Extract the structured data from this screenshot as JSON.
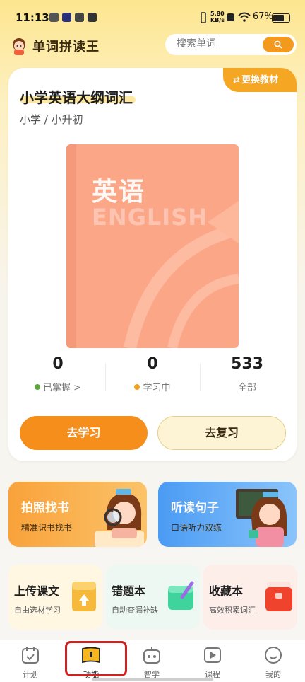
{
  "status_bar": {
    "time": "11:13",
    "net_speed": "5.80\nKB/s",
    "battery": "67%"
  },
  "header": {
    "app_name": "单词拼读王",
    "search_placeholder": "搜索单词"
  },
  "book": {
    "swap_label": "更换教材",
    "title": "小学英语大纲词汇",
    "subtitle": "小学 / 小升初",
    "cover_cn": "英语",
    "cover_en": "ENGLISH"
  },
  "stats": [
    {
      "value": "0",
      "label": "已掌握 >",
      "dot_color": "#5aa83a"
    },
    {
      "value": "0",
      "label": "学习中",
      "dot_color": "#f2a11d"
    },
    {
      "value": "533",
      "label": "全部"
    }
  ],
  "actions": {
    "learn_label": "去学习",
    "review_label": "去复习"
  },
  "features": [
    {
      "title": "拍照找书",
      "subtitle": "精准识书找书"
    },
    {
      "title": "听读句子",
      "subtitle": "口语听力双练"
    }
  ],
  "tools": [
    {
      "title": "上传课文",
      "subtitle": "自由选材学习"
    },
    {
      "title": "错题本",
      "subtitle": "自动查漏补缺"
    },
    {
      "title": "收藏本",
      "subtitle": "高效积累词汇"
    }
  ],
  "tabs": [
    {
      "label": "计划",
      "icon": "calendar-icon"
    },
    {
      "label": "功能",
      "icon": "book-icon",
      "active": true
    },
    {
      "label": "智学",
      "icon": "robot-icon"
    },
    {
      "label": "课程",
      "icon": "play-icon"
    },
    {
      "label": "我的",
      "icon": "smile-icon"
    }
  ],
  "colors": {
    "accent_orange": "#f58e1a",
    "highlight_red": "#d21f1f"
  }
}
